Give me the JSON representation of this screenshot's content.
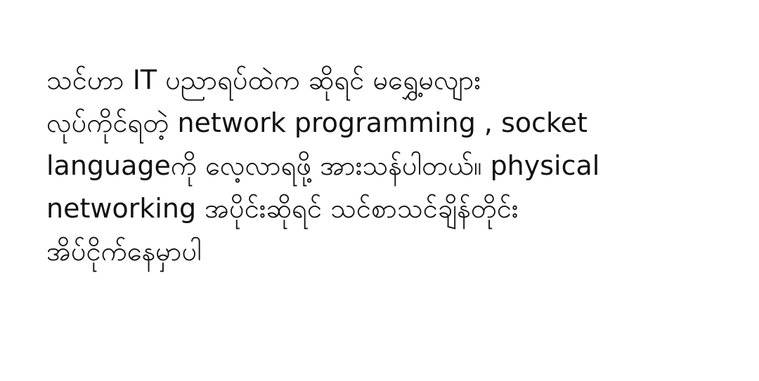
{
  "post": {
    "lines": [
      "သင်ဟာ IT ပညာရပ်ထဲက ဆိုရင် မရွှေ့မလျား",
      "လုပ်ကိုင်ရတဲ့ network programming , socket",
      "languageကို လေ့လာရဖို့ အားသန်ပါတယ်။ physical",
      "networking အပိုင်းဆိုရင် သင်စာသင်ချိန်တိုင်း",
      "အိပ်ငိုက်နေမှာပါ"
    ]
  }
}
